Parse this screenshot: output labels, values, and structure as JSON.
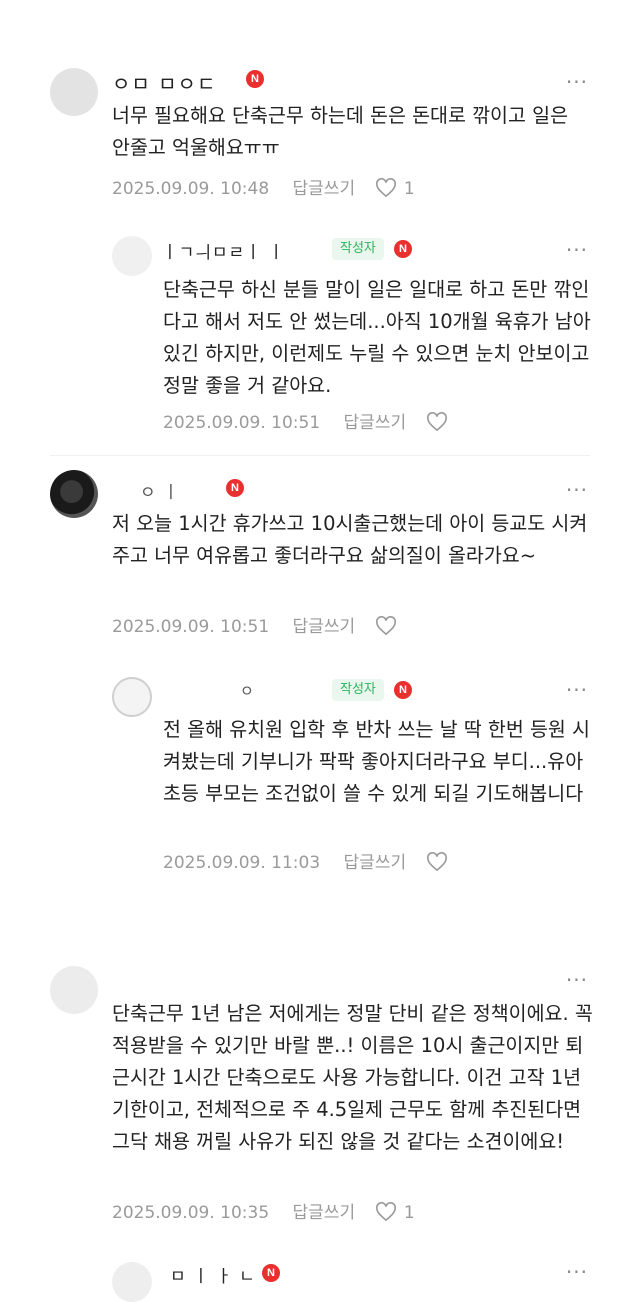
{
  "comments": [
    {
      "nickname": "ㅇㅁ ㅁㅇㄷ",
      "badge_n": "N",
      "more_label": "···",
      "text": "너무 필요해요 단축근무 하는데 돈은 돈대로 깎이고 일은 안줄고 억울해요ㅠㅠ",
      "date": "2025.09.09. 10:48",
      "reply_label": "답글쓰기",
      "likes": "1"
    },
    {
      "nickname": "ㅣㄱㅢㅁㄹㅣ ㅣ",
      "author_badge": "작성자",
      "badge_n": "N",
      "more_label": "···",
      "text": "단축근무 하신 분들 말이 일은 일대로 하고 돈만 깎인다고 해서 저도 안 썼는데...아직 10개월 육휴가 남아 있긴 하지만, 이런제도 누릴 수 있으면 눈치 안보이고 정말 좋을 거 같아요.",
      "date": "2025.09.09. 10:51",
      "reply_label": "답글쓰기"
    },
    {
      "nickname": "ㅇ ㅣ",
      "badge_n": "N",
      "more_label": "···",
      "text": "저 오늘 1시간 휴가쓰고 10시출근했는데 아이 등교도 시켜주고 너무 여유롭고 좋더라구요 삶의질이 올라가요~",
      "date": "2025.09.09. 10:51",
      "reply_label": "답글쓰기"
    },
    {
      "nickname": "ㅇ",
      "author_badge": "작성자",
      "badge_n": "N",
      "more_label": "···",
      "text": "전 올해 유치원 입학 후 반차 쓰는 날 딱 한번 등원 시켜봤는데 기부니가 팍팍 좋아지더라구요 부디...유아초등 부모는 조건없이 쓸 수 있게 되길 기도해봅니다",
      "date": "2025.09.09. 11:03",
      "reply_label": "답글쓰기"
    },
    {
      "more_label": "···",
      "text": "단축근무 1년 남은 저에게는 정말 단비 같은 정책이에요. 꼭 적용받을 수 있기만 바랄 뿐..! 이름은 10시 출근이지만 퇴근시간 1시간 단축으로도 사용 가능합니다. 이건 고작 1년 기한이고, 전체적으로 주 4.5일제 근무도 함께 추진된다면 그닥 채용 꺼릴 사유가 되진 않을 것 같다는 소견이에요!",
      "date": "2025.09.09. 10:35",
      "reply_label": "답글쓰기",
      "likes": "1"
    },
    {
      "nickname": "ㅁ ㅣ ㅏ ㄴ",
      "badge_n": "N",
      "more_label": "···"
    }
  ],
  "colors": {
    "text": "#222222",
    "meta": "#9a9a9a",
    "author_badge_bg": "#eaf7ee",
    "author_badge_text": "#2db35d",
    "new_badge": "#e8312f"
  }
}
